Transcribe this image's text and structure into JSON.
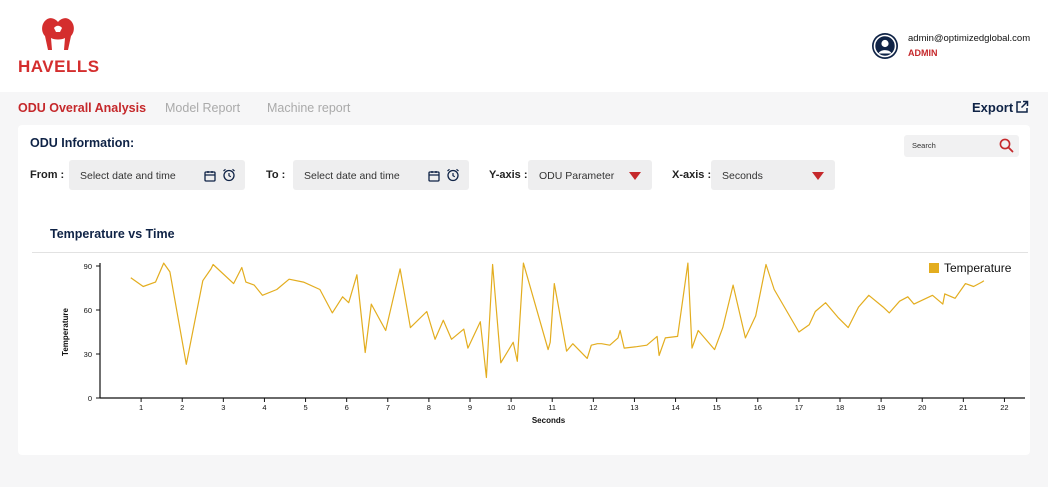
{
  "brand": {
    "name": "HAVELLS",
    "color": "#d42e2e"
  },
  "user": {
    "email": "admin@optimizedglobal.com",
    "role": "ADMIN",
    "icon": "user-circle-icon"
  },
  "nav": {
    "tabs": [
      {
        "label": "ODU Overall Analysis",
        "active": true
      },
      {
        "label": "Model Report",
        "active": false
      },
      {
        "label": "Machine report",
        "active": false
      }
    ],
    "export_label": "Export",
    "export_icon": "external-link-icon"
  },
  "filters": {
    "title": "ODU Information:",
    "search_placeholder": "Search",
    "from_label": "From :",
    "from_value": "Select date and time",
    "to_label": "To :",
    "to_value": "Select date and time",
    "yaxis_label": "Y-axis :",
    "yaxis_value": "ODU Parameter",
    "xaxis_label": "X-axis :",
    "xaxis_value": "Seconds"
  },
  "colors": {
    "accent": "#c5282b",
    "navy": "#0f2346",
    "series": "#e3ad1f"
  },
  "chart_data": {
    "type": "line",
    "title": "Temperature vs Time",
    "xlabel": "Seconds",
    "ylabel": "Temperature",
    "xlim": [
      0,
      22.5
    ],
    "ylim": [
      0,
      90
    ],
    "xticks": [
      1,
      2,
      3,
      4,
      5,
      6,
      7,
      8,
      9,
      10,
      11,
      12,
      13,
      14,
      15,
      16,
      17,
      18,
      19,
      20,
      21,
      22
    ],
    "yticks": [
      0,
      30,
      60,
      90
    ],
    "grid": false,
    "legend_position": "top-right",
    "series": [
      {
        "name": "Temperature",
        "x": [
          0.75,
          1.05,
          1.35,
          1.55,
          1.7,
          2.1,
          2.5,
          2.7,
          2.75,
          3.25,
          3.45,
          3.55,
          3.75,
          3.95,
          4.3,
          4.6,
          4.95,
          5.35,
          5.65,
          5.9,
          6.05,
          6.25,
          6.45,
          6.6,
          6.95,
          7.3,
          7.55,
          7.95,
          8.15,
          8.35,
          8.55,
          8.85,
          8.95,
          9.25,
          9.4,
          9.55,
          9.75,
          10.05,
          10.15,
          10.3,
          10.9,
          10.95,
          11.05,
          11.35,
          11.5,
          11.85,
          11.95,
          12.1,
          12.2,
          12.4,
          12.6,
          12.65,
          12.75,
          13.05,
          13.3,
          13.55,
          13.6,
          13.75,
          14.05,
          14.3,
          14.4,
          14.55,
          14.95,
          15.15,
          15.4,
          15.7,
          15.95,
          16.2,
          16.4,
          17.0,
          17.25,
          17.4,
          17.65,
          17.95,
          18.2,
          18.45,
          18.7,
          19.05,
          19.2,
          19.45,
          19.65,
          19.8,
          20.25,
          20.5,
          20.55,
          20.8,
          21.05,
          21.25,
          21.45,
          21.5
        ],
        "y": [
          82,
          76,
          79,
          92,
          86,
          23,
          80,
          88,
          91,
          78,
          89,
          79,
          77,
          70,
          74,
          81,
          79,
          74,
          58,
          69,
          65,
          84,
          31,
          64,
          46,
          88,
          48,
          59,
          40,
          53,
          40,
          47,
          34,
          52,
          14,
          91,
          24,
          38,
          25,
          92,
          33,
          38,
          78,
          32,
          37,
          27,
          36,
          37,
          37,
          36,
          41,
          46,
          34,
          35,
          36,
          42,
          29,
          41,
          42,
          92,
          34,
          46,
          33,
          48,
          77,
          41,
          56,
          91,
          74,
          45,
          50,
          59,
          65,
          55,
          48,
          62,
          70,
          62,
          58,
          66,
          69,
          64,
          70,
          64,
          71,
          68,
          78,
          76,
          79,
          80
        ]
      }
    ]
  }
}
